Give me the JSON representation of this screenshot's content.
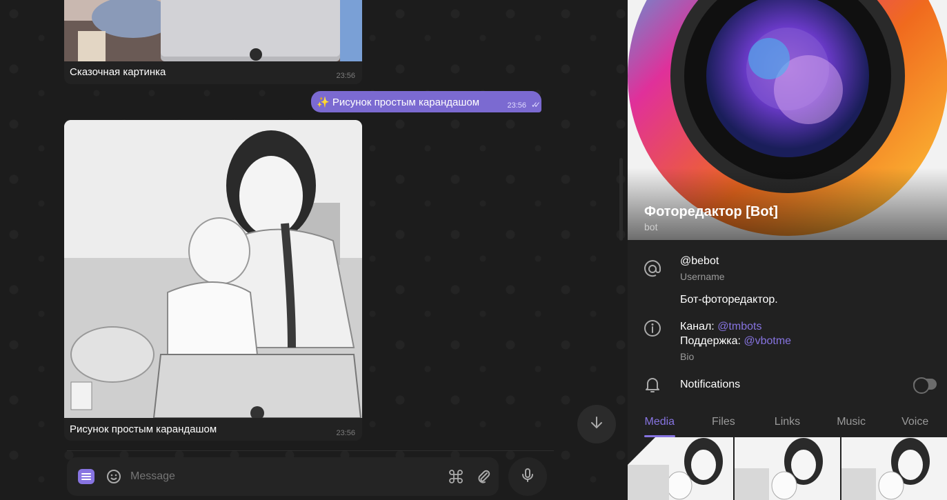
{
  "messages": [
    {
      "caption": "Сказочная картинка",
      "time": "23:56"
    },
    {
      "text": "✨ Рисунок простым карандашом",
      "time": "23:56"
    },
    {
      "caption": "Рисунок простым карандашом",
      "time": "23:56"
    }
  ],
  "composer": {
    "placeholder": "Message"
  },
  "profile": {
    "name": "Фоторедактор [Bot]",
    "status": "bot",
    "username": "@bebot",
    "username_label": "Username",
    "description": "Бот-фоторедактор.",
    "bio_channel_prefix": "Канал: ",
    "bio_channel_link": "@tmbots",
    "bio_support_prefix": "Поддержка: ",
    "bio_support_link": "@vbotme",
    "bio_label": "Bio",
    "notifications_label": "Notifications",
    "notifications_enabled": false
  },
  "tabs": [
    "Media",
    "Files",
    "Links",
    "Music",
    "Voice"
  ],
  "active_tab": "Media",
  "colors": {
    "accent": "#8774e1",
    "outgoing_bubble": "#7b6ad1",
    "background": "#1c1c1c",
    "sidebar": "#212121"
  },
  "icons": [
    "menu-icon",
    "emoji-icon",
    "command-icon",
    "attach-icon",
    "mic-icon",
    "arrow-down-icon",
    "at-icon",
    "info-icon",
    "bell-icon"
  ]
}
